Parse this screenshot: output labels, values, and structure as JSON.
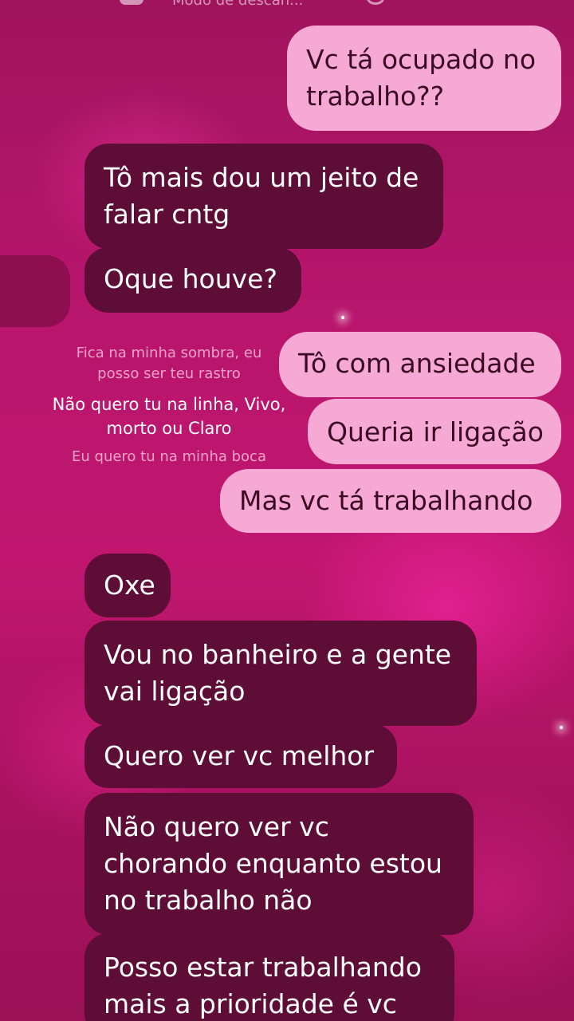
{
  "status_bar": {
    "mode_text": "Modo de descan..."
  },
  "messages": [
    {
      "id": "m1",
      "side": "out",
      "lines": [
        "Vc tá ocupado no",
        "trabalho??"
      ]
    },
    {
      "id": "m2",
      "side": "in",
      "lines": [
        "Tô mais dou um jeito de",
        "falar cntg"
      ]
    },
    {
      "id": "m3",
      "side": "in",
      "lines": [
        "Oque houve?"
      ]
    },
    {
      "id": "m4",
      "side": "out",
      "lines": [
        "Tô com ansiedade"
      ]
    },
    {
      "id": "m5",
      "side": "out",
      "lines": [
        "Queria ir ligação"
      ]
    },
    {
      "id": "m6",
      "side": "out",
      "lines": [
        "Mas vc tá trabalhando"
      ]
    },
    {
      "id": "m7",
      "side": "in",
      "lines": [
        "Oxe"
      ]
    },
    {
      "id": "m8",
      "side": "in",
      "lines": [
        "Vou no banheiro e a gente",
        "vai ligação"
      ]
    },
    {
      "id": "m9",
      "side": "in",
      "lines": [
        "Quero ver vc melhor"
      ]
    },
    {
      "id": "m10",
      "side": "in",
      "lines": [
        "Não quero ver vc",
        "chorando enquanto estou",
        "no trabalho não"
      ]
    },
    {
      "id": "m11",
      "side": "in",
      "lines": [
        "Posso estar trabalhando",
        "mais a prioridade é vc"
      ]
    }
  ],
  "lyrics": {
    "line1a": "Fica na minha sombra, eu",
    "line1b": "posso ser teu rastro",
    "line2a": "Não quero tu na linha, Vivo,",
    "line2b": "morto ou Claro",
    "line3": "Eu quero tu na minha boca"
  },
  "colors": {
    "outgoing_bubble": "#f7a9d6",
    "incoming_bubble": "#5e0d37",
    "background": "#b8156c"
  }
}
